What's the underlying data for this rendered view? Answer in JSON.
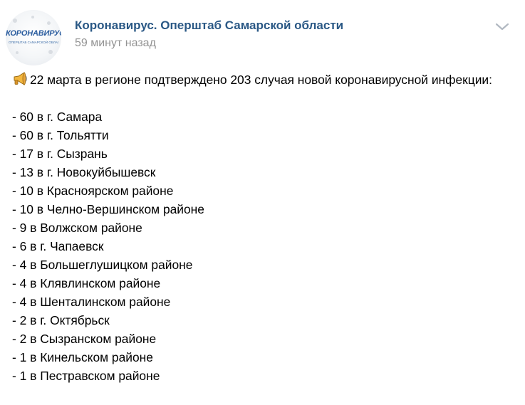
{
  "post": {
    "author": "Коронавирус. Оперштаб Самарской области",
    "time": "59 минут назад",
    "avatar": {
      "wordmark": "КОРОНАВИРУС",
      "subtitle": "ОПЕРШТАБ САМАРСКОЙ ОБЛАСТИ"
    },
    "intro_icon": "megaphone-icon",
    "intro_text": "22 марта в регионе подтверждено 203 случая новой коронавирусной инфекции:",
    "items": [
      "- 60 в г. Самара",
      "- 60 в г. Тольятти",
      "- 17 в г. Сызрань",
      "- 13 в г. Новокуйбышевск",
      "- 10 в Красноярском районе",
      "- 10 в Челно-Вершинском районе",
      "- 9 в Волжском районе",
      "- 6 в г. Чапаевск",
      "- 4 в Большеглушицком районе",
      "- 4 в Клявлинском районе",
      "- 4 в Шенталинском районе",
      "- 2 в г. Октябрьск",
      "- 2 в Сызранском районе",
      "- 1 в Кинельском районе",
      "- 1 в Пестравском районе"
    ]
  },
  "colors": {
    "author_link": "#2a5885",
    "muted_text": "#939393",
    "body_text": "#000000",
    "chevron": "#b1b8c1"
  }
}
